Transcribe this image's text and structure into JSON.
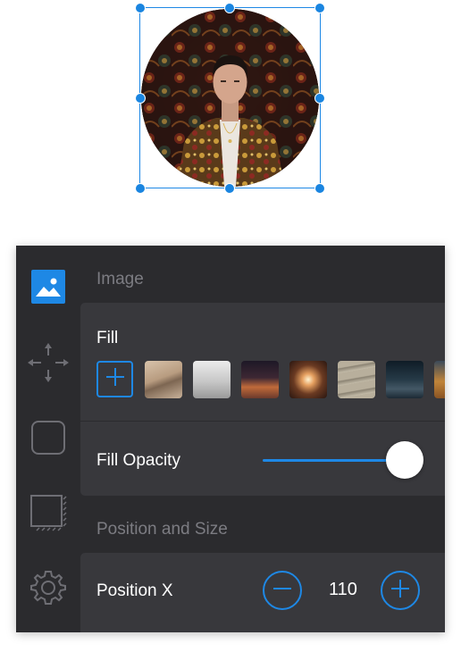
{
  "canvas": {
    "selected_object": "circle-portrait-image"
  },
  "colors": {
    "accent": "#1e88e5",
    "panel_bg": "#2b2b2e",
    "card_bg": "#38383c",
    "section_title": "#7c7c82",
    "text": "#ffffff"
  },
  "sidebar": {
    "items": [
      {
        "name": "image-tool",
        "icon": "image-icon",
        "active": true
      },
      {
        "name": "move-tool",
        "icon": "move-arrows-icon",
        "active": false
      },
      {
        "name": "shape-tool",
        "icon": "rounded-square-icon",
        "active": false
      },
      {
        "name": "shadow-tool",
        "icon": "shadow-square-icon",
        "active": false
      },
      {
        "name": "settings-tool",
        "icon": "gear-icon",
        "active": false
      }
    ]
  },
  "image_section": {
    "title": "Image",
    "fill": {
      "label": "Fill",
      "swatches": [
        {
          "name": "sand-rocks",
          "color": "#c9b29a"
        },
        {
          "name": "misty-sky",
          "color": "#d8d8d8"
        },
        {
          "name": "dusk-dunes",
          "color": "#6b3a2c"
        },
        {
          "name": "glowing-orb",
          "color": "#8a5a3a"
        },
        {
          "name": "wood-planks",
          "color": "#a79e8c"
        },
        {
          "name": "night-harbor",
          "color": "#1c2a35"
        },
        {
          "name": "amber-road",
          "color": "#b8782e"
        }
      ]
    },
    "fill_opacity": {
      "label": "Fill Opacity",
      "value": 1.0
    }
  },
  "position_section": {
    "title": "Position and Size",
    "position_x": {
      "label": "Position X",
      "value": "110"
    }
  }
}
